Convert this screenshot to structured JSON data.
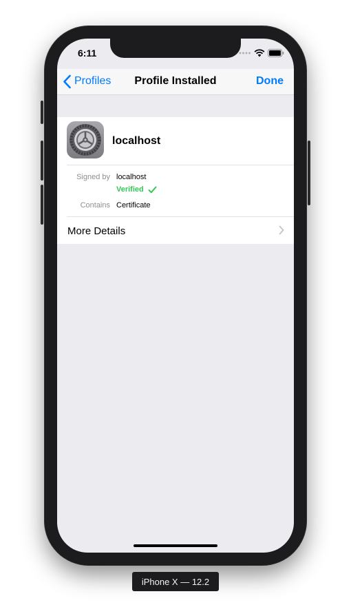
{
  "status_bar": {
    "time": "6:11",
    "icons": [
      "signal-dots-icon",
      "wifi-icon",
      "battery-icon"
    ]
  },
  "nav": {
    "back_label": "Profiles",
    "title": "Profile Installed",
    "done_label": "Done",
    "back_icon": "chevron-left-icon"
  },
  "profile": {
    "name": "localhost",
    "icon": "settings-gear-icon"
  },
  "details": {
    "signed_by_label": "Signed by",
    "signed_by_value": "localhost",
    "verified_label": "Verified",
    "verified_icon": "checkmark-icon",
    "contains_label": "Contains",
    "contains_value": "Certificate"
  },
  "more_details": {
    "label": "More Details",
    "icon": "chevron-right-icon"
  },
  "device_label": "iPhone X — 12.2",
  "colors": {
    "accent": "#007aff",
    "verified": "#34c759",
    "background": "#ebebf0"
  }
}
